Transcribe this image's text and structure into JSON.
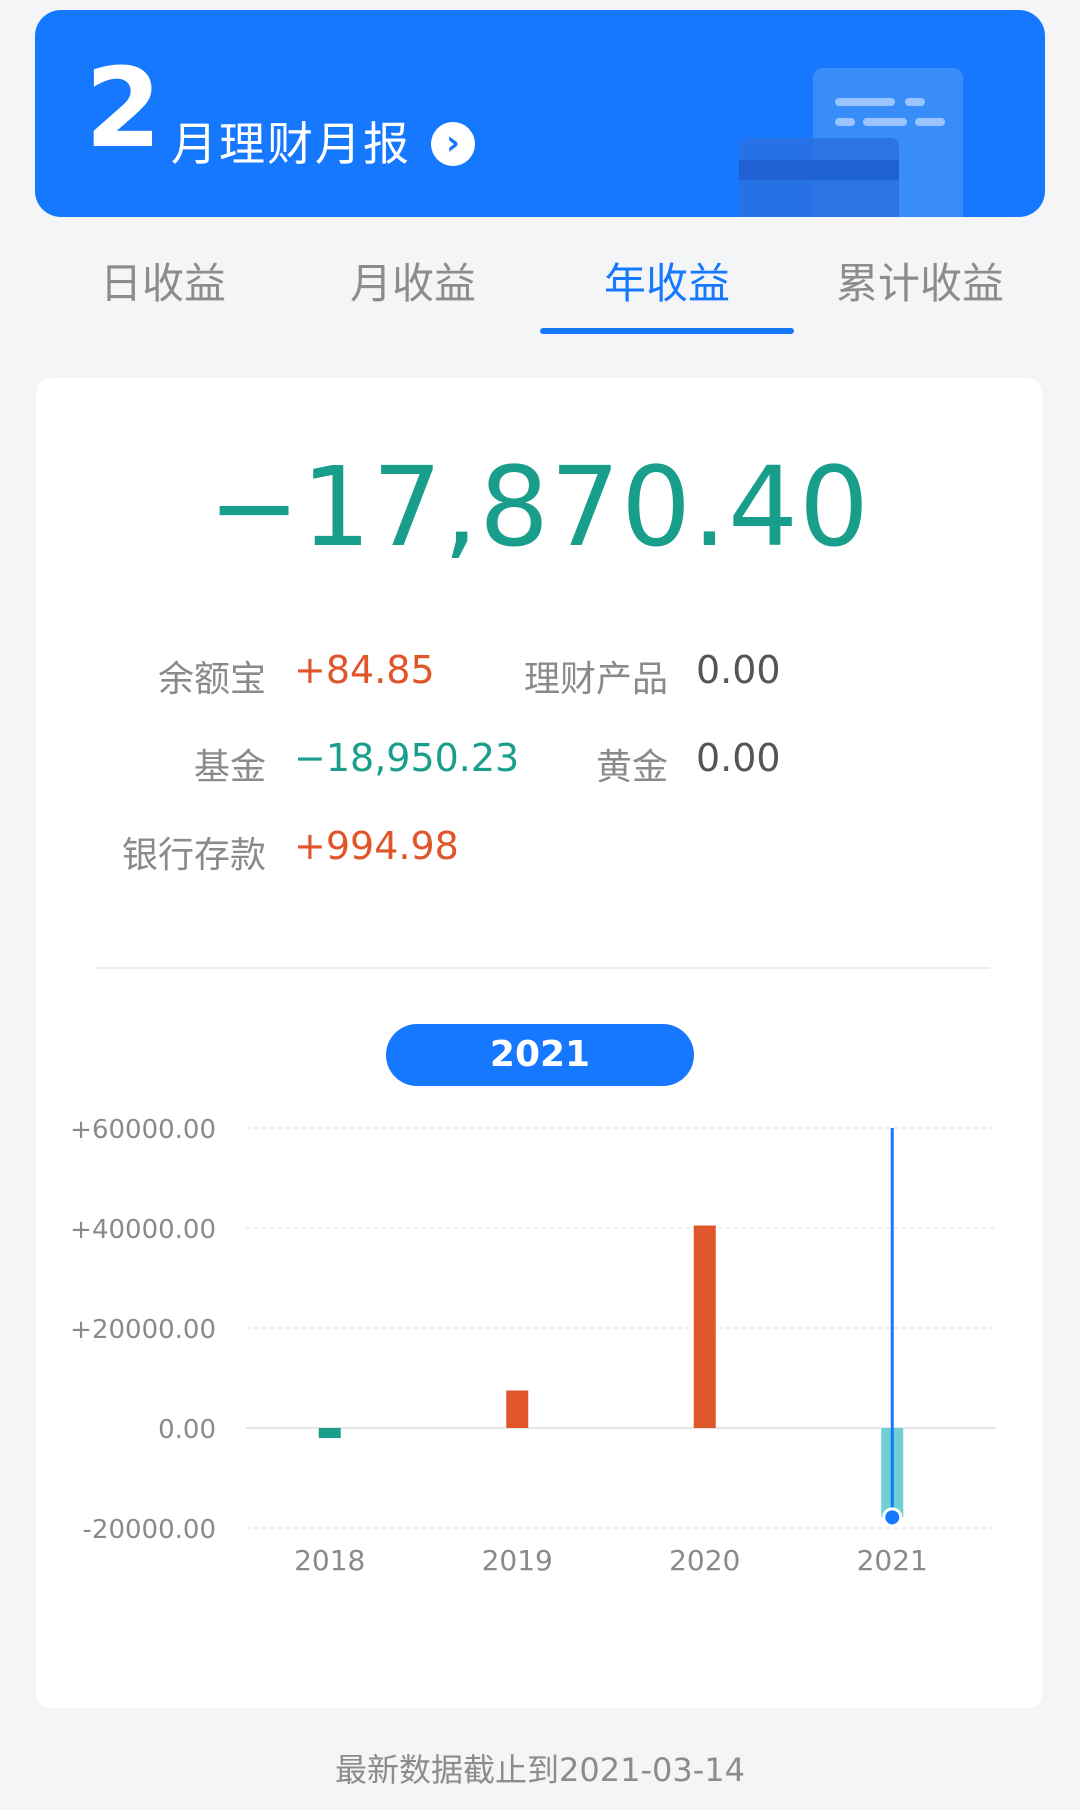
{
  "banner": {
    "month": "2",
    "title": "月理财月报",
    "arrow_glyph": "›"
  },
  "tabs": [
    {
      "label": "日收益",
      "active": false
    },
    {
      "label": "月收益",
      "active": false
    },
    {
      "label": "年收益",
      "active": true
    },
    {
      "label": "累计收益",
      "active": false
    }
  ],
  "summary": {
    "total": "−17,870.40",
    "items": [
      {
        "label": "余额宝",
        "value": "+84.85",
        "tone": "pos"
      },
      {
        "label": "理财产品",
        "value": "0.00",
        "tone": "zero"
      },
      {
        "label": "基金",
        "value": "−18,950.23",
        "tone": "neg"
      },
      {
        "label": "黄金",
        "value": "0.00",
        "tone": "zero"
      },
      {
        "label": "银行存款",
        "value": "+994.98",
        "tone": "pos"
      }
    ]
  },
  "selected_year": "2021",
  "colors": {
    "brand": "#1677ff",
    "positive": "#e0552a",
    "negative": "#1a9e8c",
    "negative_selected": "#6fcfd3"
  },
  "chart_data": {
    "type": "bar",
    "categories": [
      "2018",
      "2019",
      "2020",
      "2021"
    ],
    "values": [
      -2000,
      7500,
      40500,
      -17870.4
    ],
    "ylim": [
      -20000,
      60000
    ],
    "yticks": [
      "+60000.00",
      "+40000.00",
      "+20000.00",
      "0.00",
      "-20000.00"
    ],
    "ytick_values": [
      60000,
      40000,
      20000,
      0,
      -20000
    ],
    "selected": "2021",
    "grid": true
  },
  "footer": {
    "note": "最新数据截止到2021-03-14"
  }
}
